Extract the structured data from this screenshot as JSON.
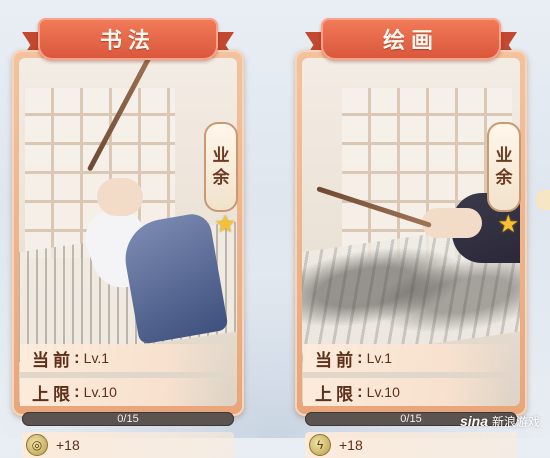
{
  "cards": [
    {
      "title": "书法",
      "tag": [
        "业",
        "余"
      ],
      "star_icon": "star-icon",
      "current_label": "当前",
      "current_value": "Lv.1",
      "limit_label": "上限",
      "limit_value": "Lv.10",
      "progress_text": "0/15",
      "progress_fraction": 0,
      "reward_icon": "spiral-coin-icon",
      "reward_value": "+18"
    },
    {
      "title": "绘画",
      "tag": [
        "业",
        "余"
      ],
      "star_icon": "star-icon",
      "current_label": "当前",
      "current_value": "Lv.1",
      "limit_label": "上限",
      "limit_value": "Lv.10",
      "progress_text": "0/15",
      "progress_fraction": 0,
      "reward_icon": "lightning-coin-icon",
      "reward_value": "+18"
    }
  ],
  "watermark": {
    "logo": "sina",
    "text": "新浪游戏"
  },
  "colors": {
    "banner": "#e0613f",
    "frame": "#eeaf85",
    "progress_track": "#5b5350",
    "star": "#f6c232"
  }
}
